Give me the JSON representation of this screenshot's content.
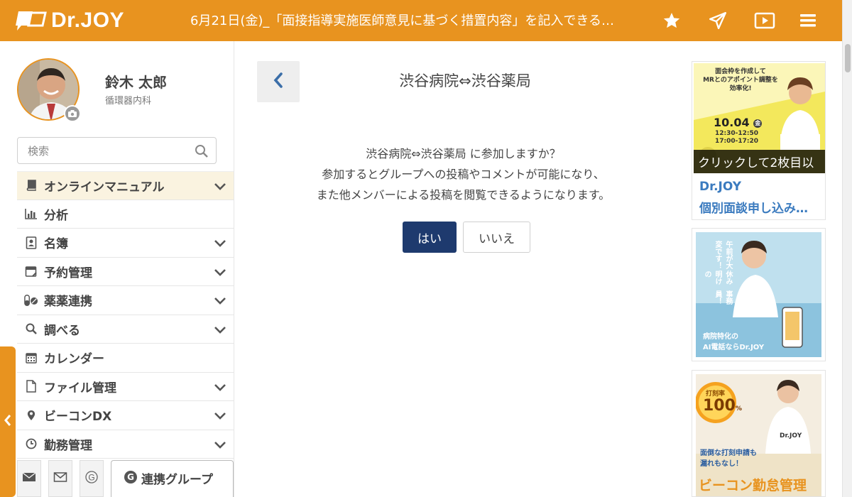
{
  "header": {
    "logo_text": "Dr.JOY",
    "ticker": "6月21日(金)_「面接指導実施医師意見に基づく措置内容」を記入できる…",
    "icons": [
      "star-icon",
      "paper-plane-icon",
      "video-play-icon",
      "hamburger-menu-icon"
    ],
    "accent_color": "#E8931F"
  },
  "profile": {
    "name": "鈴木 太郎",
    "department": "循環器内科"
  },
  "search": {
    "placeholder": "検索"
  },
  "menu": [
    {
      "label": "オンラインマニュアル",
      "icon": "book-icon",
      "expandable": true,
      "active": true
    },
    {
      "label": "分析",
      "icon": "bar-chart-icon",
      "expandable": false
    },
    {
      "label": "名簿",
      "icon": "contact-book-icon",
      "expandable": true
    },
    {
      "label": "予約管理",
      "icon": "calendar-edit-icon",
      "expandable": true
    },
    {
      "label": "薬薬連携",
      "icon": "pills-icon",
      "expandable": true
    },
    {
      "label": "調べる",
      "icon": "search-icon",
      "expandable": true
    },
    {
      "label": "カレンダー",
      "icon": "calendar-icon",
      "expandable": false
    },
    {
      "label": "ファイル管理",
      "icon": "file-icon",
      "expandable": true
    },
    {
      "label": "ビーコンDX",
      "icon": "map-marker-icon",
      "expandable": true
    },
    {
      "label": "勤務管理",
      "icon": "clock-icon",
      "expandable": true
    }
  ],
  "bottom_tabs": {
    "group_label": "連携グループ",
    "g_letter": "G"
  },
  "main": {
    "title": "渋谷病院⇔渋谷薬局",
    "confirm_lines": [
      "渋谷病院⇔渋谷薬局 に参加しますか？",
      "参加するとグループへの投稿やコメントが可能になり、",
      "また他メンバーによる投稿を閲覧できるようになります。"
    ],
    "yes_label": "はい",
    "no_label": "いいえ",
    "yes_color": "#1E3A6E"
  },
  "ads": {
    "ad1": {
      "banner_lines": [
        "面会枠を作成して",
        "MRとのアポイント調整を",
        "効率化!"
      ],
      "date": "10.04",
      "weekday": "金",
      "times": [
        "12:30-12:50",
        "17:00-17:20"
      ],
      "overlay": "クリックして2枚目以",
      "caption_title": "Dr.JOY",
      "caption_text": "個別面談申し込み…"
    },
    "ad2": {
      "vertical_lines": [
        "事務員！",
        "休み明けの",
        "午前が大変です！"
      ],
      "bottom_lines": [
        "病院特化の",
        "AI電話ならDr.JOY"
      ]
    },
    "ad3": {
      "badge_label": "打刻率",
      "badge_value": "100",
      "badge_unit": "%",
      "shirt_text": "Dr.JOY",
      "mid_lines": [
        "面倒な打刻申請も",
        "漏れもなし！"
      ],
      "bottom_text": "ビーコン勤怠管理"
    }
  }
}
